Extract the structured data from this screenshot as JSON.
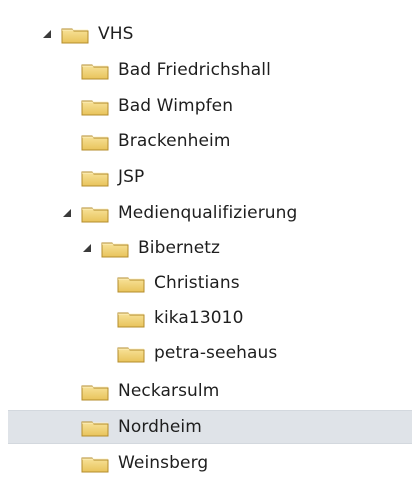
{
  "colors": {
    "selected_row_bg": "#dfe3e8",
    "folder_fill_top": "#f8e39b",
    "folder_fill_bottom": "#e8c35b",
    "folder_outline": "#b48d2c",
    "text": "#1e1e1e"
  },
  "icons": {
    "expanded_arrow": "triangle-down-right",
    "folder": "folder-icon"
  },
  "tree": {
    "items": [
      {
        "label": "VHS",
        "expanded": true
      },
      {
        "label": "Bad Friedrichshall"
      },
      {
        "label": "Bad Wimpfen"
      },
      {
        "label": "Brackenheim"
      },
      {
        "label": "JSP"
      },
      {
        "label": "Medienqualifizierung",
        "expanded": true
      },
      {
        "label": "Bibernetz",
        "expanded": true
      },
      {
        "label": "Christians"
      },
      {
        "label": "kika13010"
      },
      {
        "label": "petra-seehaus"
      },
      {
        "label": "Neckarsulm"
      },
      {
        "label": "Nordheim",
        "selected": true
      },
      {
        "label": "Weinsberg"
      }
    ]
  }
}
